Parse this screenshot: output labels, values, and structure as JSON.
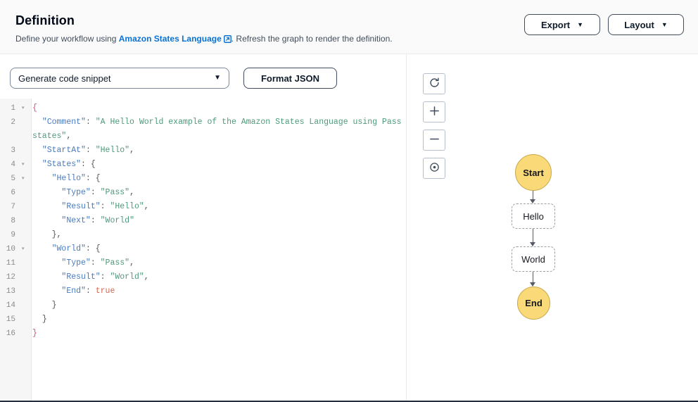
{
  "header": {
    "title": "Definition",
    "subtitle_prefix": "Define your workflow using ",
    "link_label": "Amazon States Language",
    "subtitle_suffix": ". Refresh the graph to render the definition.",
    "link_icon": "external-link-icon",
    "link_color": "#0972d3",
    "export_button": "Export",
    "layout_button": "Layout",
    "caret_glyph": "▼"
  },
  "editor_toolbar": {
    "snippet_select_value": "Generate code snippet",
    "snippet_select_caret": "▼",
    "format_json_button": "Format JSON"
  },
  "code_editor": {
    "language": "json",
    "fold_glyph": "▾",
    "lines": [
      {
        "number": "1",
        "fold": true,
        "wrapped": false,
        "tokens": [
          {
            "text": "{",
            "type": "brace"
          }
        ]
      },
      {
        "number": "2",
        "fold": false,
        "wrapped": true,
        "tokens": [
          {
            "text": "  ",
            "type": "plain"
          },
          {
            "text": "\"Comment\"",
            "type": "key"
          },
          {
            "text": ": ",
            "type": "punct"
          },
          {
            "text": "\"A Hello World example of the Amazon States Language using Pass states\"",
            "type": "str"
          },
          {
            "text": ",",
            "type": "punct"
          }
        ]
      },
      {
        "number": "3",
        "fold": false,
        "wrapped": false,
        "tokens": [
          {
            "text": "  ",
            "type": "plain"
          },
          {
            "text": "\"StartAt\"",
            "type": "key"
          },
          {
            "text": ": ",
            "type": "punct"
          },
          {
            "text": "\"Hello\"",
            "type": "str"
          },
          {
            "text": ",",
            "type": "punct"
          }
        ]
      },
      {
        "number": "4",
        "fold": true,
        "wrapped": false,
        "tokens": [
          {
            "text": "  ",
            "type": "plain"
          },
          {
            "text": "\"States\"",
            "type": "key"
          },
          {
            "text": ": ",
            "type": "punct"
          },
          {
            "text": "{",
            "type": "punct"
          }
        ]
      },
      {
        "number": "5",
        "fold": true,
        "wrapped": false,
        "tokens": [
          {
            "text": "    ",
            "type": "plain"
          },
          {
            "text": "\"Hello\"",
            "type": "key"
          },
          {
            "text": ": ",
            "type": "punct"
          },
          {
            "text": "{",
            "type": "punct"
          }
        ]
      },
      {
        "number": "6",
        "fold": false,
        "wrapped": false,
        "tokens": [
          {
            "text": "      ",
            "type": "plain"
          },
          {
            "text": "\"Type\"",
            "type": "key"
          },
          {
            "text": ": ",
            "type": "punct"
          },
          {
            "text": "\"Pass\"",
            "type": "str"
          },
          {
            "text": ",",
            "type": "punct"
          }
        ]
      },
      {
        "number": "7",
        "fold": false,
        "wrapped": false,
        "tokens": [
          {
            "text": "      ",
            "type": "plain"
          },
          {
            "text": "\"Result\"",
            "type": "key"
          },
          {
            "text": ": ",
            "type": "punct"
          },
          {
            "text": "\"Hello\"",
            "type": "str"
          },
          {
            "text": ",",
            "type": "punct"
          }
        ]
      },
      {
        "number": "8",
        "fold": false,
        "wrapped": false,
        "tokens": [
          {
            "text": "      ",
            "type": "plain"
          },
          {
            "text": "\"Next\"",
            "type": "key"
          },
          {
            "text": ": ",
            "type": "punct"
          },
          {
            "text": "\"World\"",
            "type": "str"
          }
        ]
      },
      {
        "number": "9",
        "fold": false,
        "wrapped": false,
        "tokens": [
          {
            "text": "    ",
            "type": "plain"
          },
          {
            "text": "}",
            "type": "punct"
          },
          {
            "text": ",",
            "type": "punct"
          }
        ]
      },
      {
        "number": "10",
        "fold": true,
        "wrapped": false,
        "tokens": [
          {
            "text": "    ",
            "type": "plain"
          },
          {
            "text": "\"World\"",
            "type": "key"
          },
          {
            "text": ": ",
            "type": "punct"
          },
          {
            "text": "{",
            "type": "punct"
          }
        ]
      },
      {
        "number": "11",
        "fold": false,
        "wrapped": false,
        "tokens": [
          {
            "text": "      ",
            "type": "plain"
          },
          {
            "text": "\"Type\"",
            "type": "key"
          },
          {
            "text": ": ",
            "type": "punct"
          },
          {
            "text": "\"Pass\"",
            "type": "str"
          },
          {
            "text": ",",
            "type": "punct"
          }
        ]
      },
      {
        "number": "12",
        "fold": false,
        "wrapped": false,
        "tokens": [
          {
            "text": "      ",
            "type": "plain"
          },
          {
            "text": "\"Result\"",
            "type": "key"
          },
          {
            "text": ": ",
            "type": "punct"
          },
          {
            "text": "\"World\"",
            "type": "str"
          },
          {
            "text": ",",
            "type": "punct"
          }
        ]
      },
      {
        "number": "13",
        "fold": false,
        "wrapped": false,
        "tokens": [
          {
            "text": "      ",
            "type": "plain"
          },
          {
            "text": "\"End\"",
            "type": "key"
          },
          {
            "text": ": ",
            "type": "punct"
          },
          {
            "text": "true",
            "type": "bool"
          }
        ]
      },
      {
        "number": "14",
        "fold": false,
        "wrapped": false,
        "tokens": [
          {
            "text": "    ",
            "type": "plain"
          },
          {
            "text": "}",
            "type": "punct"
          }
        ]
      },
      {
        "number": "15",
        "fold": false,
        "wrapped": false,
        "tokens": [
          {
            "text": "  ",
            "type": "plain"
          },
          {
            "text": "}",
            "type": "punct"
          }
        ]
      },
      {
        "number": "16",
        "fold": false,
        "wrapped": false,
        "tokens": [
          {
            "text": "}",
            "type": "brace"
          }
        ]
      }
    ]
  },
  "graph": {
    "controls": [
      {
        "name": "refresh-graph-button",
        "icon": "refresh-icon"
      },
      {
        "name": "zoom-in-button",
        "icon": "plus-icon"
      },
      {
        "name": "zoom-out-button",
        "icon": "minus-icon"
      },
      {
        "name": "center-graph-button",
        "icon": "target-icon"
      }
    ],
    "node_fill_terminal": "#fad978",
    "node_border_terminal": "#c9a94c",
    "node_border_state": "#9aa0a6",
    "edge_color": "#545b64",
    "nodes": [
      {
        "id": "start",
        "label": "Start",
        "shape": "circle"
      },
      {
        "id": "hello",
        "label": "Hello",
        "shape": "rounded-rect-dashed"
      },
      {
        "id": "world",
        "label": "World",
        "shape": "rounded-rect-dashed"
      },
      {
        "id": "end",
        "label": "End",
        "shape": "circle"
      }
    ],
    "edges": [
      {
        "from": "start",
        "to": "hello"
      },
      {
        "from": "hello",
        "to": "world"
      },
      {
        "from": "world",
        "to": "end"
      }
    ]
  }
}
